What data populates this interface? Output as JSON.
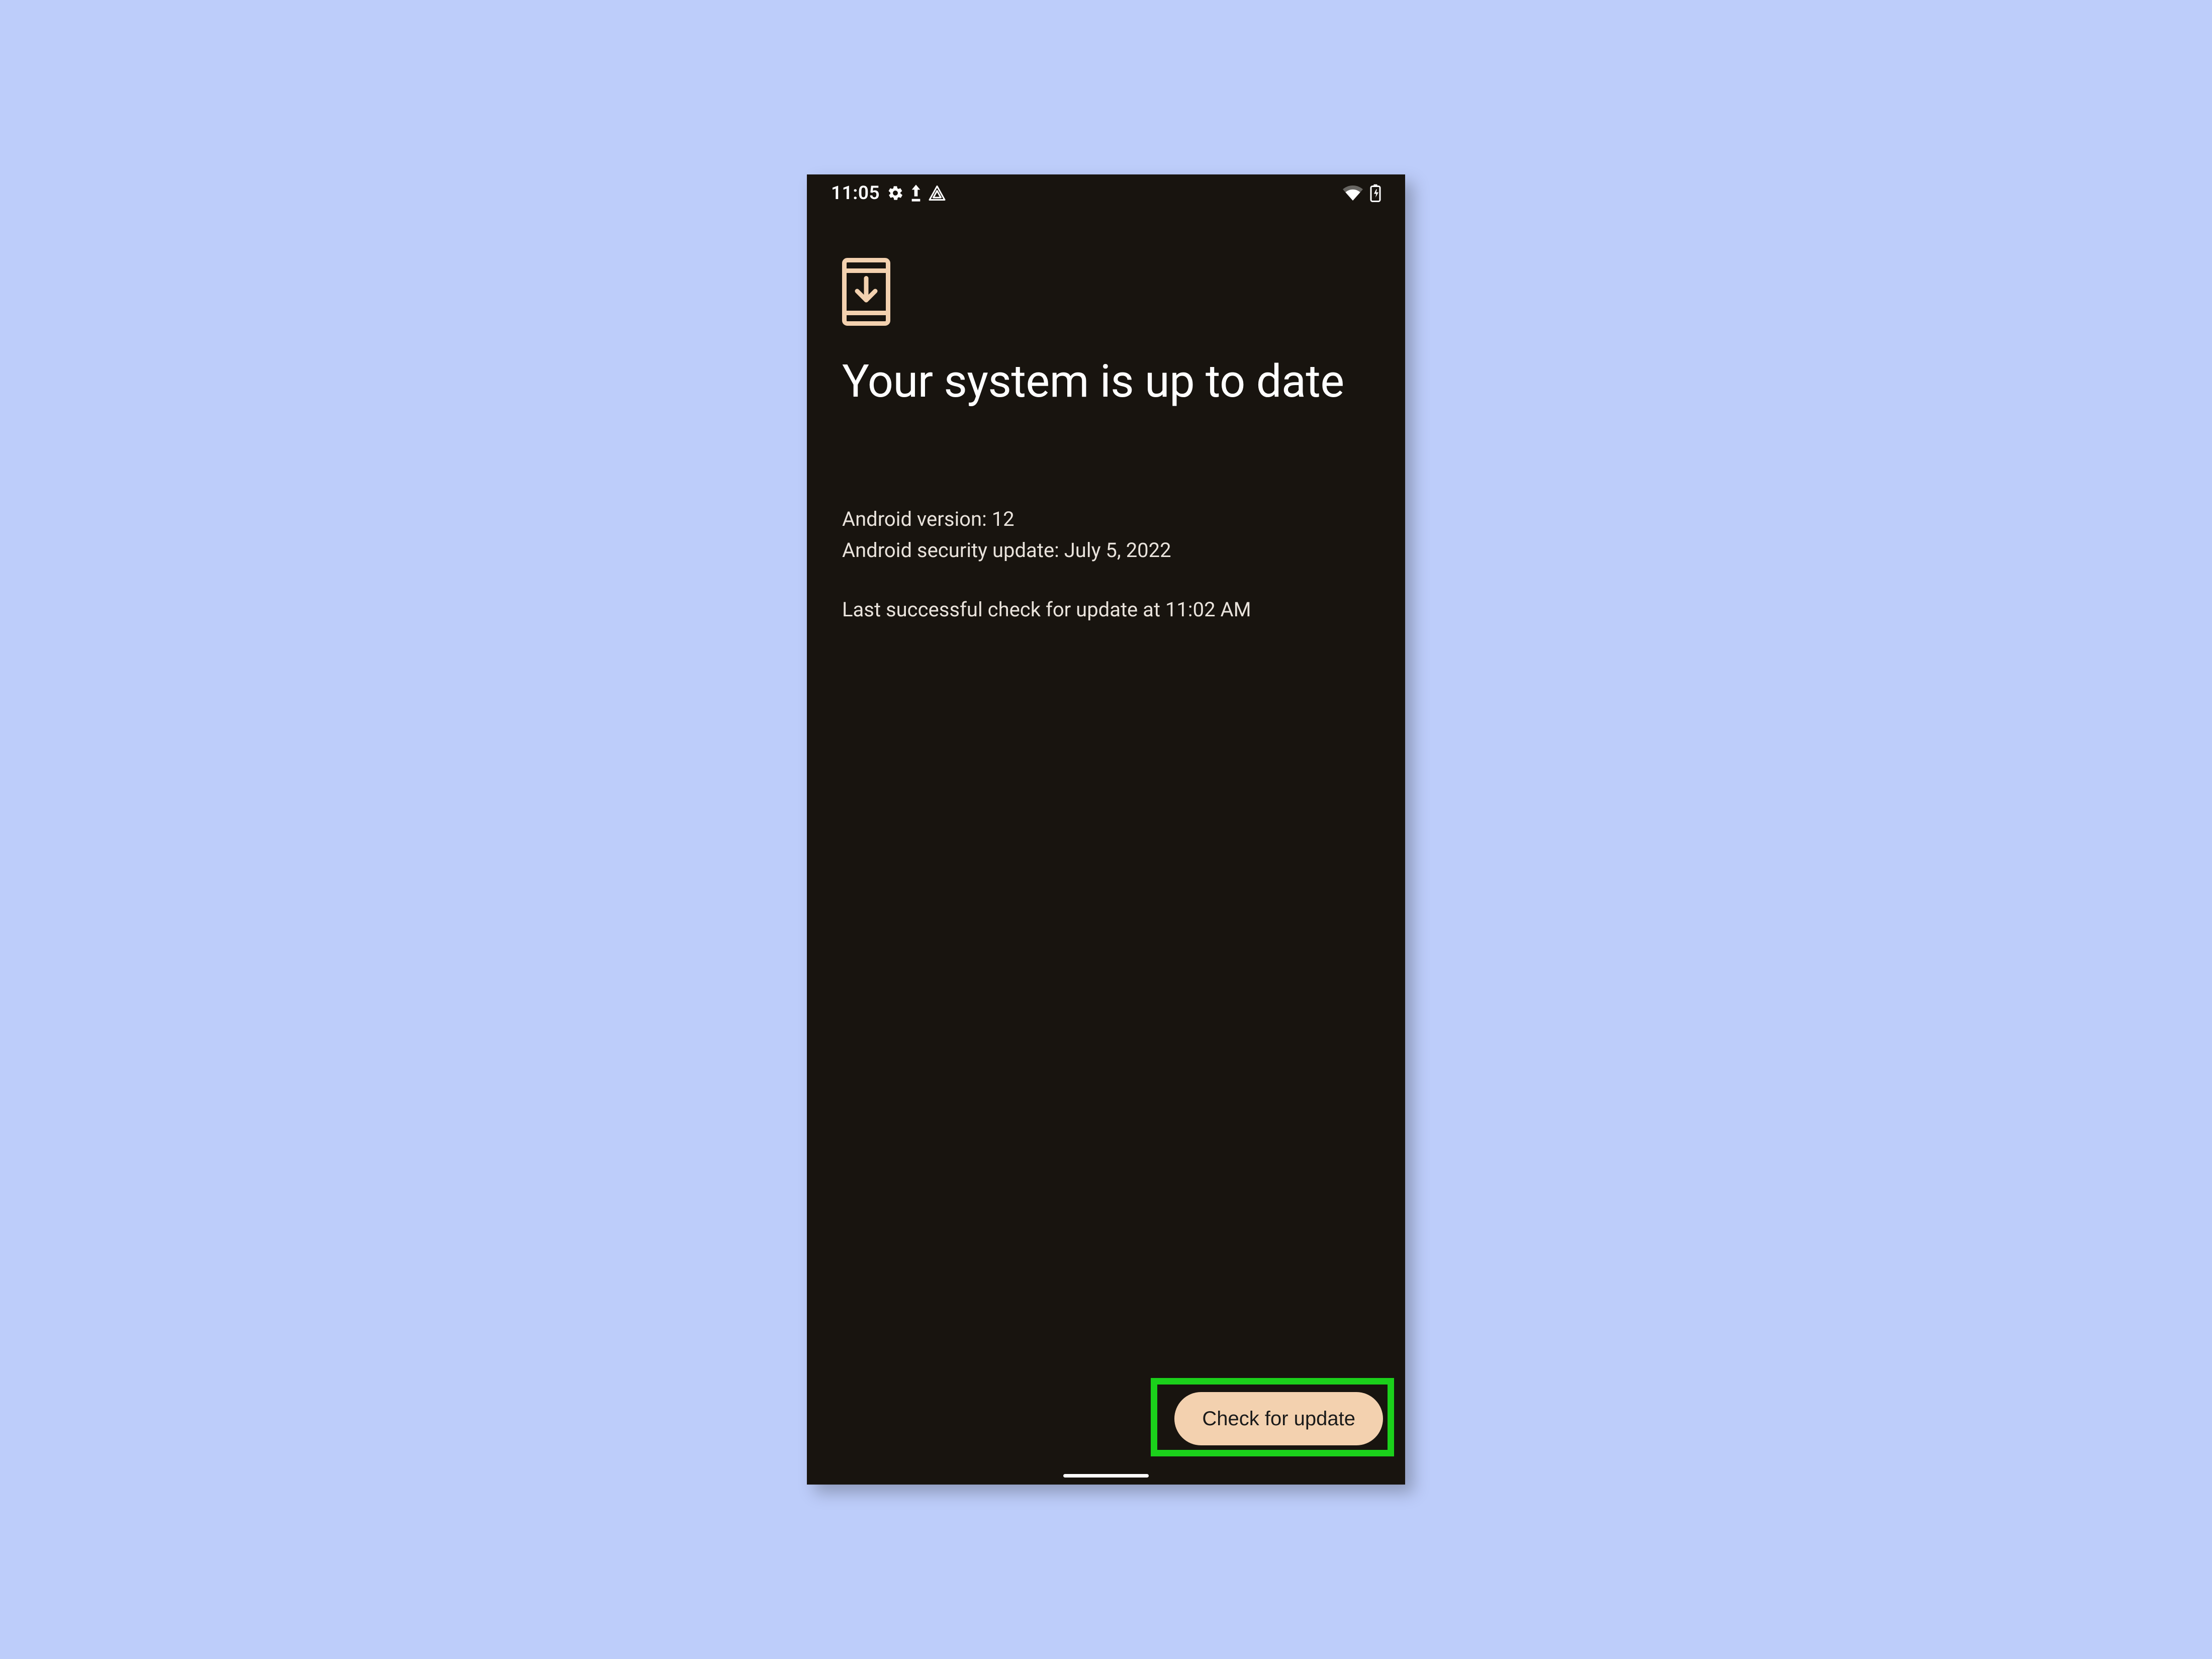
{
  "status_bar": {
    "time": "11:05"
  },
  "main": {
    "title": "Your system is up to date",
    "android_version_line": "Android version: 12",
    "security_update_line": "Android security update: July 5, 2022",
    "last_check_line": "Last successful check for update at 11:02 AM"
  },
  "actions": {
    "check_for_update_label": "Check for update"
  },
  "colors": {
    "page_bg": "#bdcdfa",
    "phone_bg": "#18140f",
    "accent": "#f3d1af",
    "highlight": "#1bd01b"
  }
}
